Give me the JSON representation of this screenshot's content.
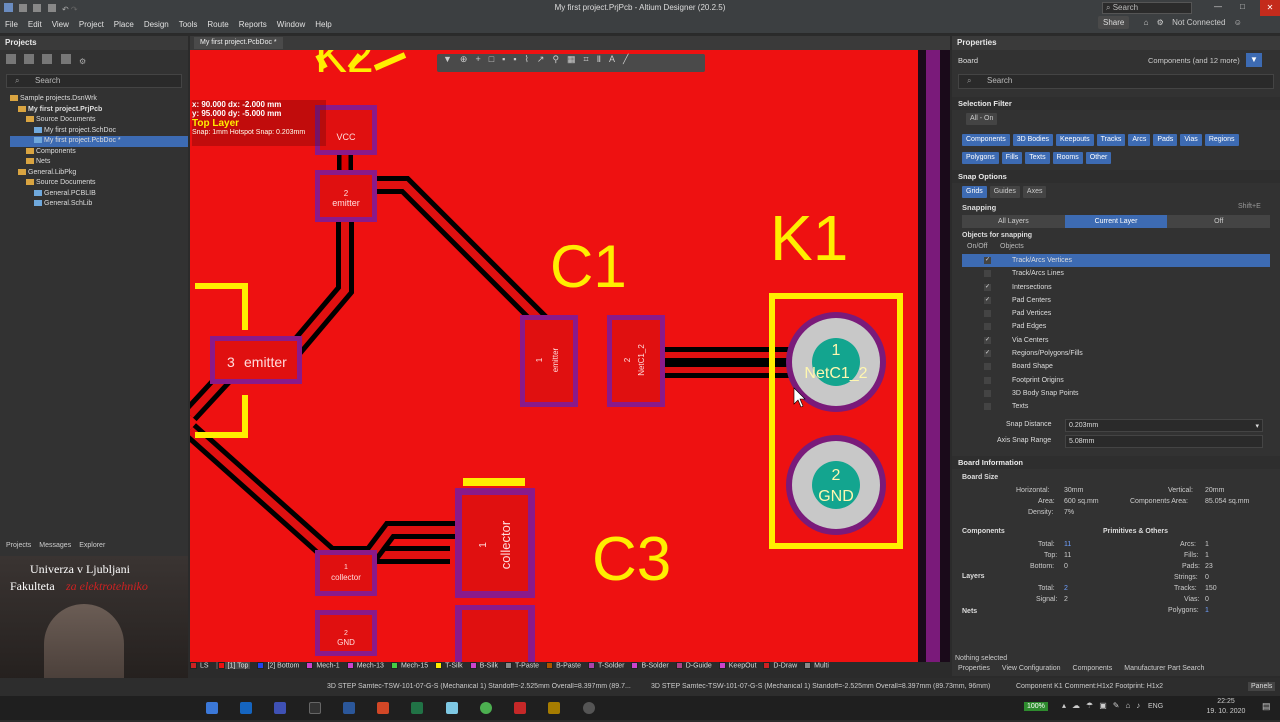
{
  "window": {
    "title": "My first project.PrjPcb - Altium Designer (20.2.5)",
    "search_label": "Search"
  },
  "menu": [
    "File",
    "Edit",
    "View",
    "Project",
    "Place",
    "Design",
    "Tools",
    "Route",
    "Reports",
    "Window",
    "Help"
  ],
  "toolbar_right": {
    "share": "Share",
    "status": "Not Connected"
  },
  "projects_panel": {
    "title": "Projects",
    "search_placeholder": "Search",
    "tree": [
      {
        "label": "Sample projects.DsnWrk",
        "indent": 0
      },
      {
        "label": "My first project.PrjPcb",
        "indent": 1,
        "bold": true
      },
      {
        "label": "Source Documents",
        "indent": 2
      },
      {
        "label": "My first project.SchDoc",
        "indent": 3
      },
      {
        "label": "My first project.PcbDoc *",
        "indent": 3,
        "selected": true
      },
      {
        "label": "Components",
        "indent": 2
      },
      {
        "label": "Nets",
        "indent": 2
      },
      {
        "label": "General.LibPkg",
        "indent": 1
      },
      {
        "label": "Source Documents",
        "indent": 2
      },
      {
        "label": "General.PCBLIB",
        "indent": 3
      },
      {
        "label": "General.SchLib",
        "indent": 3
      }
    ],
    "tabs": [
      "Projects",
      "Messages",
      "Explorer"
    ]
  },
  "webcam": {
    "line1": "Univerza v Ljubljani",
    "line2a": "Fakulteta",
    "line2b": "za elektrotehniko"
  },
  "document_tab": "My first project.PcbDoc *",
  "coords": {
    "xline": "x: 90.000   dx: -2.000 mm",
    "yline": "y: 95.000   dy: -5.000 mm",
    "layer": "Top Layer",
    "snap": "Snap: 1mm Hotspot Snap: 0.203mm"
  },
  "pcb": {
    "designators": {
      "k2": "K2",
      "c1": "C1",
      "k1": "K1",
      "c3": "C3"
    },
    "pads": {
      "vcc": "VCC",
      "emitter_top_num": "2",
      "emitter_top": "emitter",
      "emitter_big_num": "3",
      "emitter_big": "emitter",
      "c1_p1_num": "1",
      "c1_p1": "emitter",
      "c1_p2_num": "2",
      "c1_p2": "NetC1_2",
      "k1_p1_num": "1",
      "k1_p1": "NetC1_2",
      "k1_p2_num": "2",
      "k1_p2": "GND",
      "collector_big_num": "1",
      "collector_big": "collector",
      "collector_small_num": "1",
      "collector_small": "collector",
      "gnd_small_num": "2",
      "gnd_small": "GND"
    }
  },
  "layers": [
    {
      "label": "LS",
      "color": "#cc2222"
    },
    {
      "label": "[1] Top",
      "color": "#ee1111",
      "active": true
    },
    {
      "label": "[2] Bottom",
      "color": "#2244ee"
    },
    {
      "label": "Mech-1",
      "color": "#cc44cc"
    },
    {
      "label": "Mech-13",
      "color": "#cc44cc"
    },
    {
      "label": "Mech-15",
      "color": "#44cc44"
    },
    {
      "label": "T-Silk",
      "color": "#ffee00"
    },
    {
      "label": "B-Silk",
      "color": "#cc44cc"
    },
    {
      "label": "T-Paste",
      "color": "#888888"
    },
    {
      "label": "B-Paste",
      "color": "#aa5500"
    },
    {
      "label": "T-Solder",
      "color": "#aa44aa"
    },
    {
      "label": "B-Solder",
      "color": "#cc44cc"
    },
    {
      "label": "D-Guide",
      "color": "#aa4488"
    },
    {
      "label": "KeepOut",
      "color": "#cc44cc"
    },
    {
      "label": "D-Draw",
      "color": "#cc2222"
    },
    {
      "label": "Multi",
      "color": "#888888"
    }
  ],
  "properties": {
    "title": "Properties",
    "type": "Board",
    "filter": "Components (and 12 more)",
    "search_placeholder": "Search",
    "selection_filter": {
      "title": "Selection Filter",
      "all_on": "All - On",
      "buttons": [
        "Components",
        "3D Bodies",
        "Keepouts",
        "Tracks",
        "Arcs",
        "Pads",
        "Vias",
        "Regions",
        "Polygons",
        "Fills",
        "Texts",
        "Rooms",
        "Other"
      ]
    },
    "snap_options": {
      "title": "Snap Options",
      "modes": [
        "Grids",
        "Guides",
        "Axes"
      ],
      "snapping_label": "Snapping",
      "shortcut": "Shift+E",
      "snapping_choices": [
        "All Layers",
        "Current Layer",
        "Off"
      ],
      "objects_title": "Objects for snapping",
      "col_onoff": "On/Off",
      "col_objects": "Objects",
      "objects": [
        {
          "label": "Track/Arcs Vertices",
          "on": true,
          "hi": true
        },
        {
          "label": "Track/Arcs Lines",
          "on": false
        },
        {
          "label": "Intersections",
          "on": true
        },
        {
          "label": "Pad Centers",
          "on": true
        },
        {
          "label": "Pad Vertices",
          "on": false
        },
        {
          "label": "Pad Edges",
          "on": false
        },
        {
          "label": "Via Centers",
          "on": true
        },
        {
          "label": "Regions/Polygons/Fills",
          "on": true
        },
        {
          "label": "Board Shape",
          "on": false
        },
        {
          "label": "Footprint Origins",
          "on": false
        },
        {
          "label": "3D Body Snap Points",
          "on": false
        },
        {
          "label": "Texts",
          "on": false
        }
      ],
      "snap_distance_label": "Snap Distance",
      "snap_distance": "0.203mm",
      "axis_range_label": "Axis Snap Range",
      "axis_range": "5.08mm"
    },
    "board_info": {
      "title": "Board Information",
      "size_title": "Board Size",
      "horizontal_label": "Horizontal:",
      "horizontal": "30mm",
      "vertical_label": "Vertical:",
      "vertical": "20mm",
      "area_label": "Area:",
      "area": "600 sq.mm",
      "comp_area_label": "Components Area:",
      "comp_area": "85.054 sq.mm",
      "density_label": "Density:",
      "density": "7%",
      "components_title": "Components",
      "prims_title": "Primitives & Others",
      "total_label": "Total:",
      "total": "11",
      "top_label": "Top:",
      "top": "11",
      "bottom_label": "Bottom:",
      "bottom": "0",
      "arcs_label": "Arcs:",
      "arcs": "1",
      "fills_label": "Fills:",
      "fills": "1",
      "pads_label": "Pads:",
      "pads": "23",
      "strings_label": "Strings:",
      "strings": "0",
      "tracks_label": "Tracks:",
      "tracks": "150",
      "vias_label": "Vias:",
      "vias": "0",
      "polygons_label": "Polygons:",
      "polygons": "1",
      "layers_title": "Layers",
      "layers_total_label": "Total:",
      "layers_total": "2",
      "signal_label": "Signal:",
      "signal": "2",
      "nets_title": "Nets"
    },
    "nothing_selected": "Nothing selected",
    "bottom_tabs": [
      "Properties",
      "View Configuration",
      "Components",
      "Manufacturer Part Search"
    ]
  },
  "status": {
    "left": "3D STEP Samtec-TSW-101-07-G-S (Mechanical 1)  Standoff=-2.525mm  Overall=8.397mm  (89.7...",
    "mid": "3D STEP Samtec-TSW-101-07-G-S (Mechanical 1)  Standoff=-2.525mm  Overall=8.397mm  (89.73mm, 96mm)",
    "right": "Component K1 Comment:H1x2 Footprint: H1x2",
    "panels": "Panels"
  },
  "taskbar": {
    "battery": "100%",
    "lang": "ENG",
    "time": "22:25",
    "date": "19. 10. 2020"
  }
}
